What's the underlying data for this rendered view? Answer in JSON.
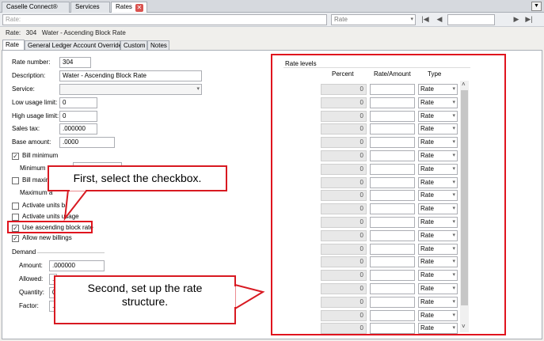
{
  "tabs": [
    {
      "label": "Caselle Connect®"
    },
    {
      "label": "Services"
    },
    {
      "label": "Rates"
    }
  ],
  "toolbar": {
    "search_label": "Rate:",
    "search_dropdown": "Rate"
  },
  "record": {
    "label": "Rate:",
    "number": "304",
    "name": "Water - Ascending Block Rate"
  },
  "subtabs": [
    "Rate",
    "General Ledger Account Override",
    "Custom",
    "Notes"
  ],
  "form": {
    "rate_number_label": "Rate number:",
    "rate_number": "304",
    "description_label": "Description:",
    "description": "Water - Ascending Block Rate",
    "service_label": "Service:",
    "low_usage_label": "Low usage limit:",
    "low_usage": "0",
    "high_usage_label": "High usage limit:",
    "high_usage": "0",
    "sales_tax_label": "Sales tax:",
    "sales_tax": ".000000",
    "base_amount_label": "Base amount:",
    "base_amount": ".0000",
    "bill_minimum": "Bill minimum",
    "minimum_amount_label": "Minimum ar",
    "bill_maximum": "Bill maxim",
    "maximum_amount_label": "Maximum a",
    "activate_units_base": "Activate units base",
    "activate_units_usage": "Activate units usage",
    "use_ascending": "Use ascending block rate",
    "allow_new_billings": "Allow new billings",
    "demand_label": "Demand",
    "amount_label": "Amount:",
    "amount": ".000000",
    "allowed_label": "Allowed:",
    "allowed": ".0",
    "quantity_label": "Quantity:",
    "quantity": "0.",
    "factor_label": "Factor:",
    "factor": ".0"
  },
  "rate_levels": {
    "title": "Rate levels",
    "col_percent": "Percent",
    "col_rate": "Rate/Amount",
    "col_type": "Type",
    "rows": [
      {
        "percent": "0",
        "type": "Rate"
      },
      {
        "percent": "0",
        "type": "Rate"
      },
      {
        "percent": "0",
        "type": "Rate"
      },
      {
        "percent": "0",
        "type": "Rate"
      },
      {
        "percent": "0",
        "type": "Rate"
      },
      {
        "percent": "0",
        "type": "Rate"
      },
      {
        "percent": "0",
        "type": "Rate"
      },
      {
        "percent": "0",
        "type": "Rate"
      },
      {
        "percent": "0",
        "type": "Rate"
      },
      {
        "percent": "0",
        "type": "Rate"
      },
      {
        "percent": "0",
        "type": "Rate"
      },
      {
        "percent": "0",
        "type": "Rate"
      },
      {
        "percent": "0",
        "type": "Rate"
      },
      {
        "percent": "0",
        "type": "Rate"
      },
      {
        "percent": "0",
        "type": "Rate"
      },
      {
        "percent": "0",
        "type": "Rate"
      },
      {
        "percent": "0",
        "type": "Rate"
      },
      {
        "percent": "0",
        "type": "Rate"
      },
      {
        "percent": "0",
        "type": "Rate"
      }
    ]
  },
  "callouts": {
    "first": "First, select the checkbox.",
    "second": "Second, set up the rate structure."
  },
  "colors": {
    "annotation_red": "#e0141e",
    "close_red": "#d9534f"
  }
}
